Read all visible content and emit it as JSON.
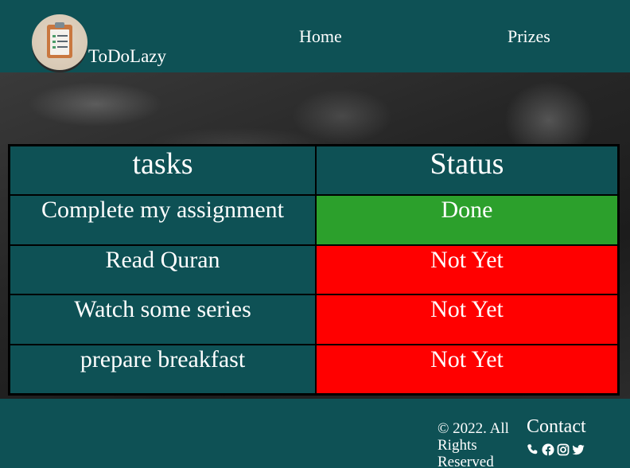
{
  "header": {
    "brand": "ToDoLazy",
    "nav": [
      {
        "label": "Home"
      },
      {
        "label": "Prizes"
      }
    ]
  },
  "table": {
    "headers": [
      "tasks",
      "Status"
    ],
    "rows": [
      {
        "task": "Complete my assignment",
        "status": "Done"
      },
      {
        "task": "Read Quran",
        "status": "Not Yet"
      },
      {
        "task": "Watch some series",
        "status": "Not Yet"
      },
      {
        "task": "prepare breakfast",
        "status": "Not Yet"
      }
    ]
  },
  "footer": {
    "copyright": "© 2022. All Rights Reserved",
    "contact_title": "Contact",
    "icons": [
      "phone-icon",
      "facebook-icon",
      "instagram-icon",
      "twitter-icon"
    ]
  },
  "colors": {
    "primary": "#0e5155",
    "done": "#2ca02c",
    "not_yet": "#ff0000"
  }
}
